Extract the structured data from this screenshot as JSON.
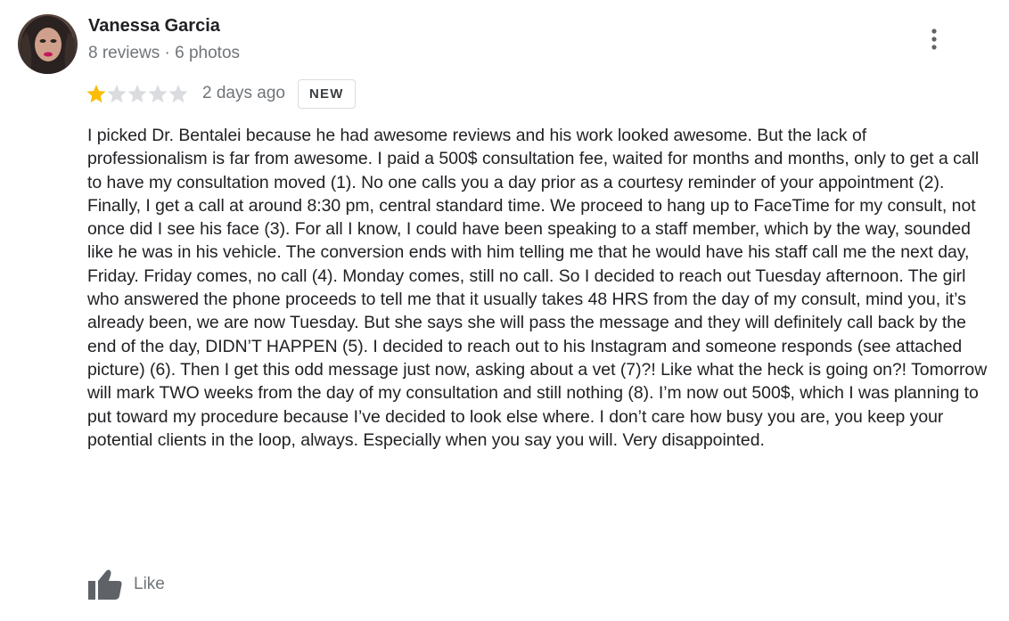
{
  "author": {
    "name": "Vanessa Garcia",
    "meta": "8 reviews · 6 photos"
  },
  "rating": {
    "value": 1,
    "max": 5,
    "filled_color": "#fbbc04",
    "empty_color": "#dadce0"
  },
  "date": "2 days ago",
  "badge": "NEW",
  "review_text": "I picked Dr. Bentalei because he had awesome reviews and his work looked awesome.  But the lack of professionalism is far from awesome. I paid a 500$ consultation fee, waited for months and months, only to get a call to have my consultation moved (1). No one calls you a day prior as a courtesy reminder of your appointment (2). Finally, I get a call at around 8:30 pm, central standard time. We proceed to hang up to FaceTime for my consult, not once did I see his face (3). For all I know, I could have been speaking to a staff member, which by the way, sounded like he was in his vehicle. The conversion ends with him telling me that he would have his staff call me the next day, Friday. Friday comes, no call (4). Monday comes, still no call. So I decided to reach out Tuesday afternoon. The girl who answered the phone proceeds to tell me that it usually takes 48 HRS from the day of my consult, mind you, it’s already been, we are now Tuesday. But she says she will pass the message and they will definitely call back by the end of the day, DIDN’T HAPPEN (5). I decided to reach out to his Instagram and someone responds (see attached picture) (6). Then I get this odd message just now, asking about a vet (7)?!  Like what the heck is going on?!  Tomorrow will mark TWO weeks from the day of my consultation and still nothing (8). I’m now out 500$, which I was planning to put toward my procedure because I’ve decided to look else where. I don’t care how busy you are, you keep your potential clients in the loop, always. Especially when you say you will. Very disappointed.",
  "like": {
    "label": "Like",
    "icon": "thumbs-up-icon",
    "color": "#5f6368"
  },
  "menu_icon": "more-vert-icon"
}
